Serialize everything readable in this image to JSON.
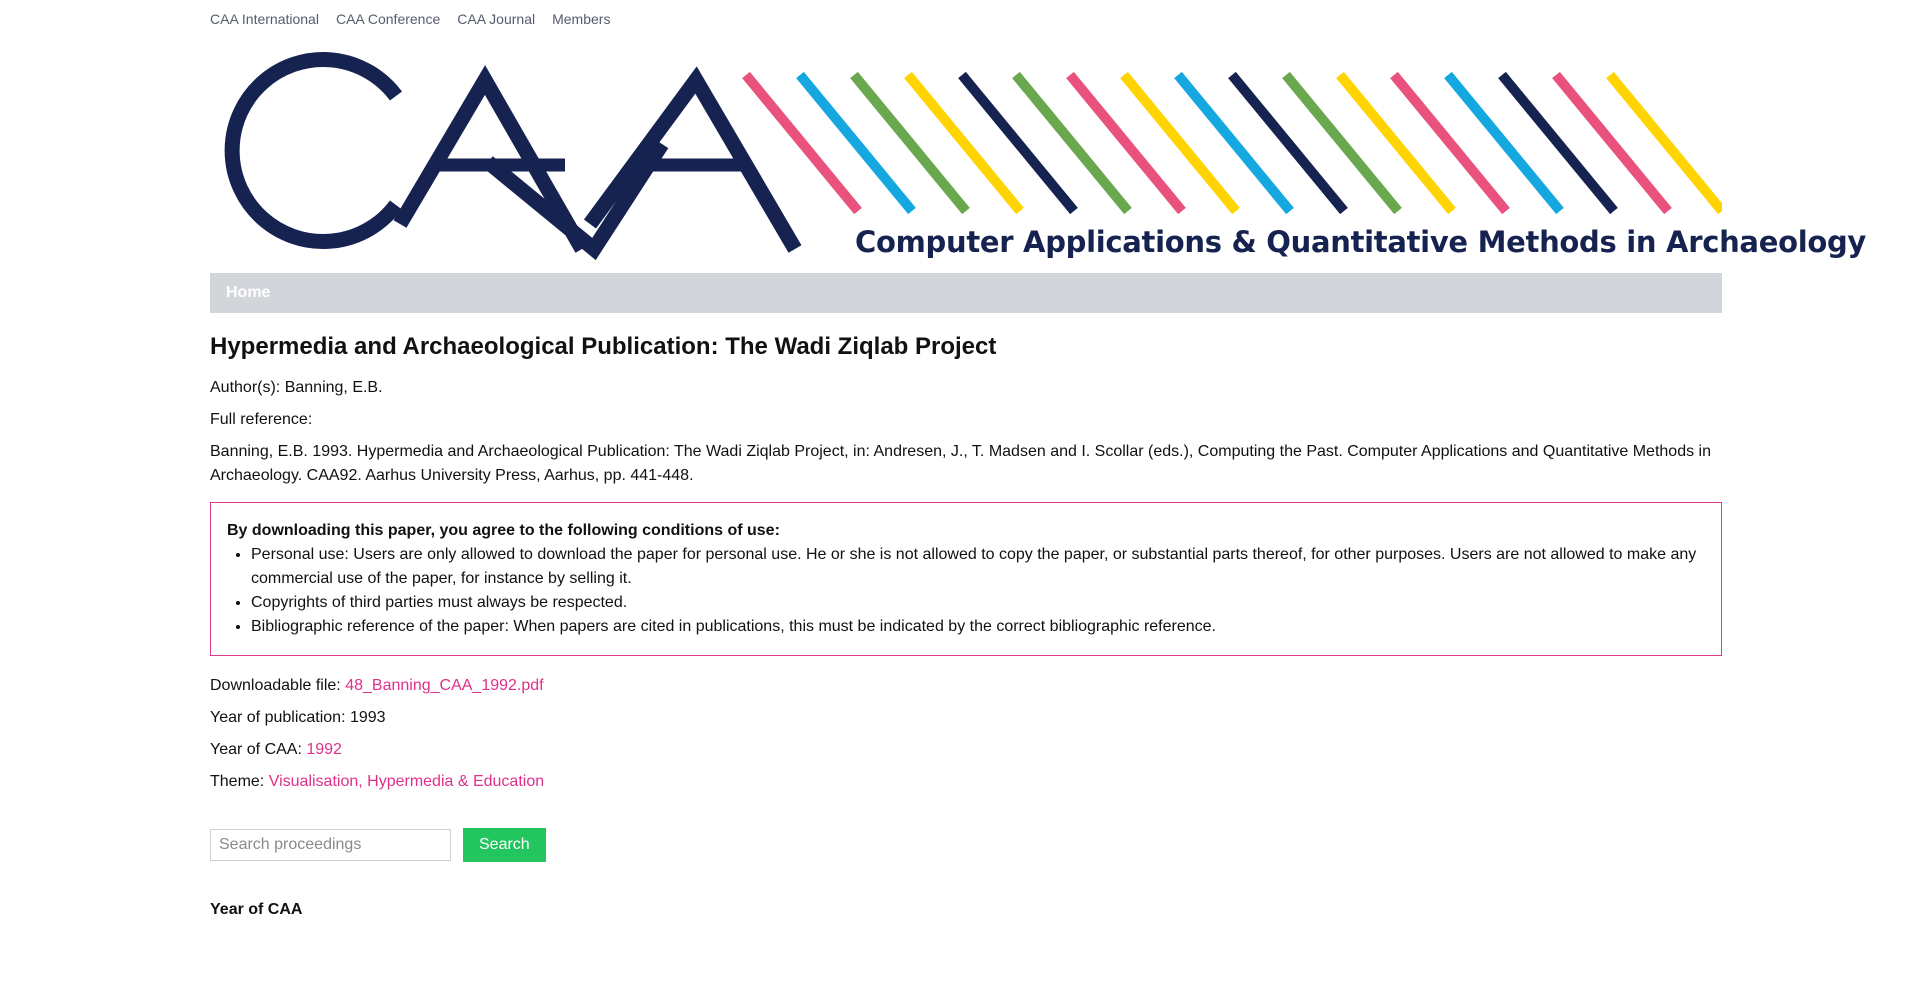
{
  "topnav": {
    "items": [
      "CAA International",
      "CAA Conference",
      "CAA Journal",
      "Members"
    ]
  },
  "banner": {
    "logo_text": "CAA",
    "tagline": "Computer Applications & Quantitative Methods in Archaeology",
    "colors": {
      "navy": "#16224f",
      "pink": "#e8527d",
      "cyan": "#15a8e0",
      "green": "#6aa84f",
      "yellow": "#ffd400"
    }
  },
  "menu": {
    "home": "Home"
  },
  "paper": {
    "title": "Hypermedia and Archaeological Publication: The Wadi Ziqlab Project",
    "authors_label": "Author(s):",
    "authors": "Banning, E.B.",
    "full_reference_label": "Full reference:",
    "full_reference": "Banning, E.B. 1993. Hypermedia and Archaeological Publication: The Wadi Ziqlab Project, in: Andresen, J., T. Madsen and I. Scollar (eds.), Computing the Past. Computer Applications and Quantitative Methods in Archaeology. CAA92. Aarhus University Press, Aarhus, pp. 441-448."
  },
  "terms": {
    "heading": "By downloading this paper, you agree to the following conditions of use:",
    "items": [
      "Personal use: Users are only allowed to download the paper for personal use. He or she is not allowed to copy the paper, or substantial parts thereof, for other purposes. Users are not allowed to make any commercial use of the paper, for instance by selling it.",
      "Copyrights of third parties must always be respected.",
      "Bibliographic reference of the paper: When papers are cited in publications, this must be indicated by the correct bibliographic reference."
    ],
    "border_color": "#e23b8b"
  },
  "meta": {
    "file_label": "Downloadable file:",
    "file": "48_Banning_CAA_1992.pdf",
    "year_pub_label": "Year of publication:",
    "year_pub": "1993",
    "year_caa_label": "Year of CAA:",
    "year_caa": "1992",
    "theme_label": "Theme:",
    "theme": "Visualisation, Hypermedia & Education",
    "link_color": "#e0308a"
  },
  "search": {
    "placeholder": "Search proceedings",
    "button": "Search",
    "button_color": "#22c55e"
  },
  "sidebar": {
    "year_heading": "Year of CAA"
  }
}
